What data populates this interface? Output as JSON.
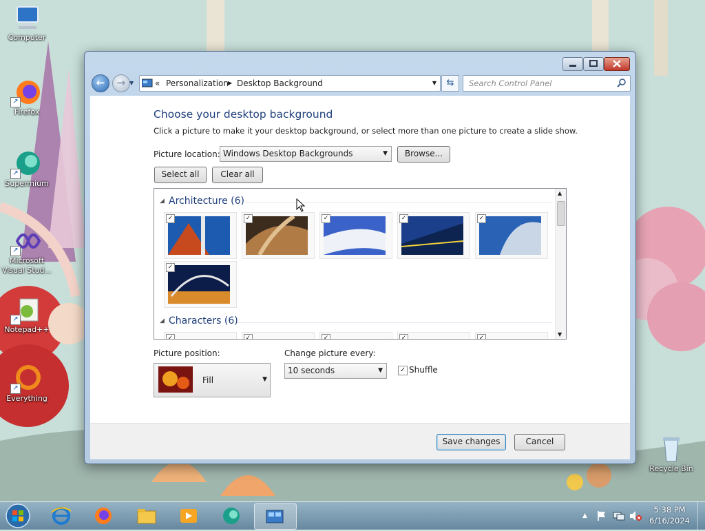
{
  "desktop": {
    "icons": [
      {
        "label": "Computer",
        "icon": "computer-icon"
      },
      {
        "label": "Firefox",
        "icon": "firefox-icon"
      },
      {
        "label": "Supermium",
        "icon": "supermium-icon"
      },
      {
        "label": "Microsoft Visual Stud...",
        "icon": "visual-studio-icon"
      },
      {
        "label": "Notepad++",
        "icon": "notepadpp-icon"
      },
      {
        "label": "Everything",
        "icon": "everything-icon"
      },
      {
        "label": "Recycle Bin",
        "icon": "recycle-bin-icon"
      }
    ]
  },
  "window": {
    "breadcrumb": {
      "root_glyph": "«",
      "items": [
        "Personalization",
        "Desktop Background"
      ]
    },
    "search_placeholder": "Search Control Panel",
    "heading": "Choose your desktop background",
    "instructions": "Click a picture to make it your desktop background, or select more than one picture to create a slide show.",
    "picture_location_label": "Picture location:",
    "picture_location_value": "Windows Desktop Backgrounds",
    "browse_label": "Browse...",
    "select_all_label": "Select all",
    "clear_all_label": "Clear all",
    "groups": [
      {
        "name": "Architecture (6)",
        "count": 6,
        "checked": true
      },
      {
        "name": "Characters (6)",
        "count": 6,
        "checked": true
      }
    ],
    "picture_position_label": "Picture position:",
    "picture_position_value": "Fill",
    "change_every_label": "Change picture every:",
    "change_every_value": "10 seconds",
    "shuffle_label": "Shuffle",
    "shuffle_checked": true,
    "save_label": "Save changes",
    "cancel_label": "Cancel"
  },
  "taskbar": {
    "pinned": [
      "start-orb",
      "internet-explorer-icon",
      "firefox-icon",
      "file-explorer-icon",
      "media-player-icon",
      "supermium-icon",
      "control-panel-icon"
    ],
    "active": "control-panel-icon",
    "time": "5:38 PM",
    "date": "6/16/2024"
  },
  "colors": {
    "heading": "#1e3f7a",
    "window_frame": "#b4cbe2",
    "taskbar": "#7096b0"
  }
}
